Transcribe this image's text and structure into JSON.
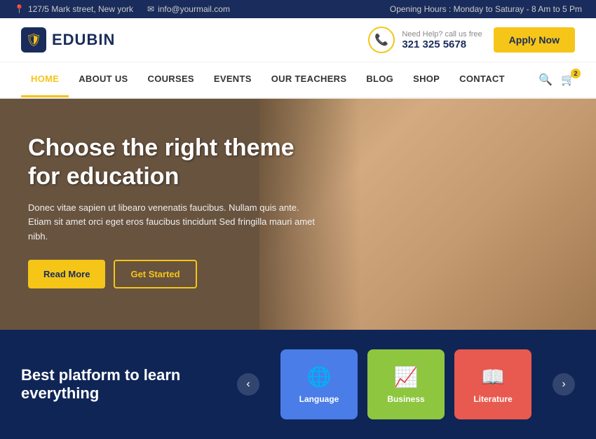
{
  "topbar": {
    "address": "127/5 Mark street, New york",
    "email": "info@yourmail.com",
    "hours": "Opening Hours : Monday to Saturay - 8 Am to 5 Pm",
    "location_icon": "📍",
    "email_icon": "✉"
  },
  "header": {
    "logo_text": "EDUBIN",
    "need_help": "Need Help? call us free",
    "phone": "321 325 5678",
    "apply_label": "Apply Now",
    "phone_icon": "📞"
  },
  "nav": {
    "links": [
      {
        "label": "HOME",
        "active": true
      },
      {
        "label": "ABOUT US",
        "active": false
      },
      {
        "label": "COURSES",
        "active": false
      },
      {
        "label": "EVENTS",
        "active": false
      },
      {
        "label": "OUR TEACHERS",
        "active": false
      },
      {
        "label": "BLOG",
        "active": false
      },
      {
        "label": "SHOP",
        "active": false
      },
      {
        "label": "CONTACT",
        "active": false
      }
    ],
    "cart_count": "2"
  },
  "hero": {
    "title": "Choose the right theme for education",
    "description": "Donec vitae sapien ut libearo venenatis faucibus. Nullam quis ante. Etiam sit amet orci eget eros faucibus tincidunt Sed fringilla mauri amet nibh.",
    "read_more": "Read More",
    "get_started": "Get Started"
  },
  "bottom": {
    "tagline": "Best platform to learn everything",
    "categories": [
      {
        "label": "Language",
        "color": "blue",
        "icon": "🌐"
      },
      {
        "label": "Business",
        "color": "green",
        "icon": "📈"
      },
      {
        "label": "Literature",
        "color": "red",
        "icon": "📖"
      }
    ],
    "prev_icon": "‹",
    "next_icon": "›"
  }
}
